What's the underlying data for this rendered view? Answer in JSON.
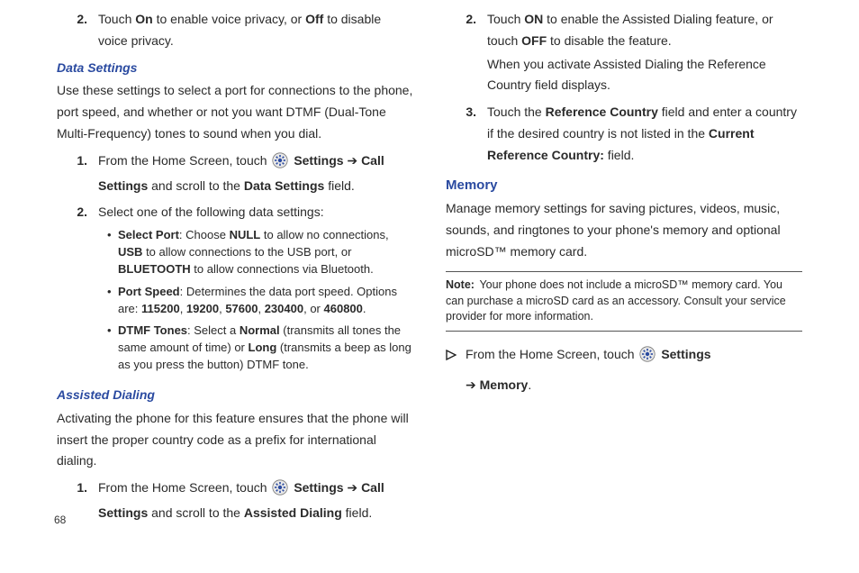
{
  "pageNumber": "68",
  "col1": {
    "step2_a": "Touch ",
    "step2_on": "On",
    "step2_b": " to enable voice privacy, or ",
    "step2_off": "Off",
    "step2_c": " to disable voice privacy.",
    "dataSettingsHead": "Data Settings",
    "dataSettingsBody": "Use these settings to select a port for connections to the phone, port speed, and whether or not you want DTMF (Dual-Tone Multi-Frequency) tones to sound when you dial.",
    "ds_step1_a": "From the Home Screen, touch ",
    "ds_step1_settings": "Settings",
    "ds_step1_arrow": " ➔ ",
    "ds_step1_call": "Call Settings",
    "ds_step1_b": " and scroll to the ",
    "ds_step1_field": "Data Settings",
    "ds_step1_c": " field.",
    "ds_step2": "Select one of the following data settings:",
    "b1_label": "Select Port",
    "b1_a": ": Choose ",
    "b1_null": "NULL",
    "b1_b": " to allow no connections, ",
    "b1_usb": "USB",
    "b1_c": " to allow connections to the USB port, or ",
    "b1_bt": "BLUETOOTH",
    "b1_d": " to allow connections via Bluetooth.",
    "b2_label": "Port Speed",
    "b2_a": ": Determines the data port speed. Options are: ",
    "b2_v1": "115200",
    "b2_v2": "19200",
    "b2_v3": "57600",
    "b2_v4": "230400",
    "b2_or": ", or ",
    "b2_v5": "460800",
    "b3_label": "DTMF Tones",
    "b3_a": ": Select a ",
    "b3_normal": "Normal",
    "b3_b": " (transmits all tones the same amount of time) or ",
    "b3_long": "Long",
    "b3_c": " (transmits a beep as long as you press the button) DTMF tone.",
    "assistedHead": "Assisted Dialing",
    "assistedBody": "Activating the phone for this feature ensures that the phone will insert the proper country code as a prefix for international dialing.",
    "ad_step1_a": "From the Home Screen, touch ",
    "ad_step1_settings": "Settings",
    "ad_step1_arrow": " ➔ ",
    "ad_step1_call": "Call Settings",
    "ad_step1_b": " and scroll to the ",
    "ad_step1_field": "Assisted Dialing",
    "ad_step1_c": " field."
  },
  "col2": {
    "step2_a": "Touch ",
    "step2_on": "ON",
    "step2_b": " to enable the Assisted Dialing feature, or touch ",
    "step2_off": "OFF",
    "step2_c": " to disable the feature.",
    "step2_d": "When you activate Assisted Dialing the Reference Country field displays.",
    "step3_a": "Touch the ",
    "step3_ref": "Reference Country",
    "step3_b": " field and enter a country if the desired country is not listed in the ",
    "step3_cur": "Current Reference Country:",
    "step3_c": " field.",
    "memoryHead": "Memory",
    "memoryBody": "Manage memory settings for saving pictures, videos, music, sounds, and ringtones to your phone's memory and optional microSD™ memory card.",
    "noteLabel": "Note:",
    "noteBody": "Your phone does not include a microSD™ memory card. You can purchase a microSD card as an accessory. Consult your service provider for more information.",
    "mem_step_a": "From the Home Screen, touch ",
    "mem_step_settings": "Settings",
    "mem_step_arrow": "➔ ",
    "mem_step_memory": "Memory",
    "mem_step_c": "."
  }
}
